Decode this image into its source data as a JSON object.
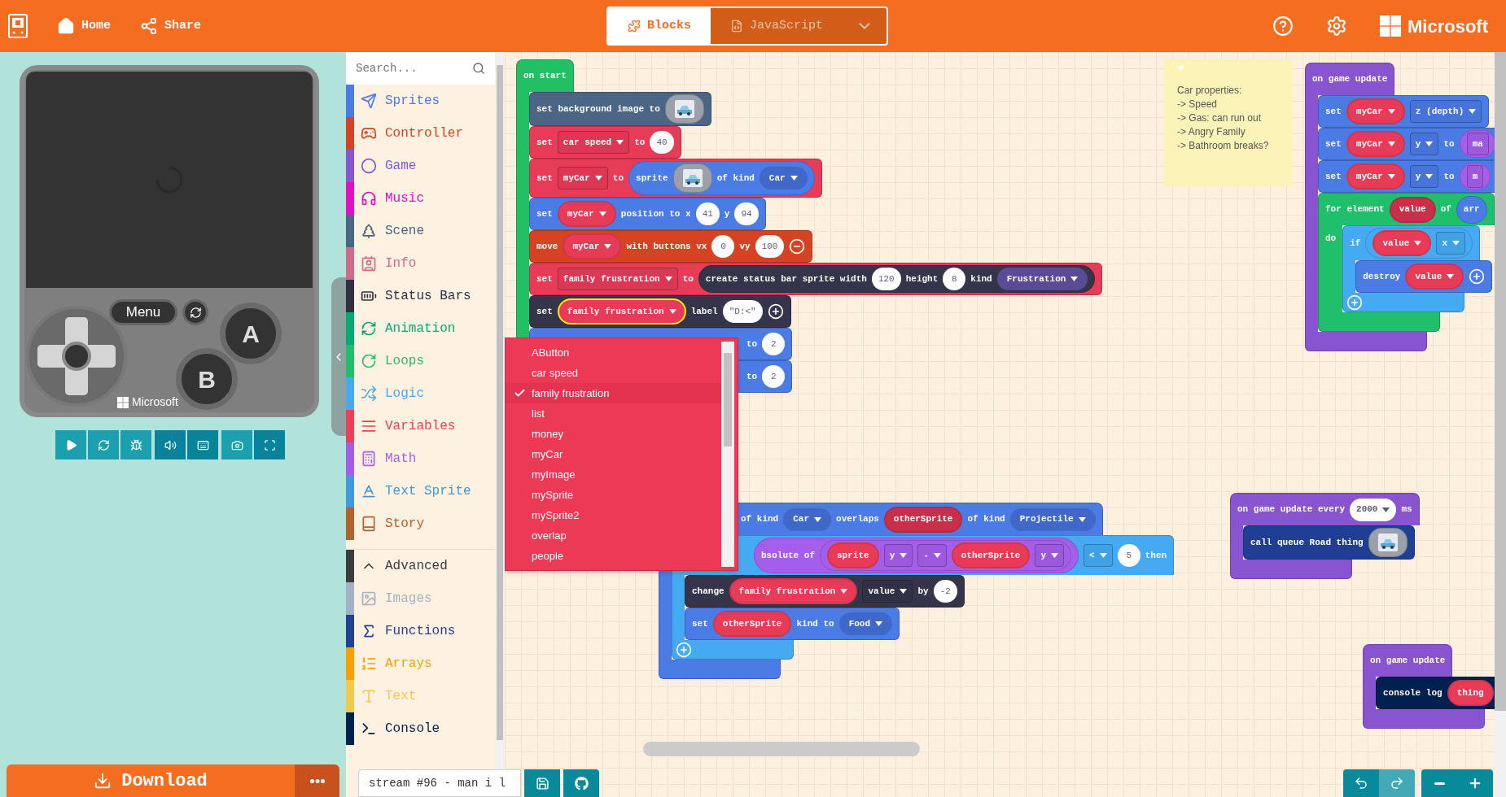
{
  "header": {
    "home": "Home",
    "share": "Share",
    "brand": "Microsoft",
    "tabs": [
      {
        "label": "Blocks",
        "selected": true
      },
      {
        "label": "JavaScript",
        "selected": false
      }
    ]
  },
  "simulator": {
    "menu": "Menu",
    "button_a": "A",
    "button_b": "B",
    "brand": "Microsoft"
  },
  "download": "Download",
  "toolbox": {
    "placeholder": "Search...",
    "categories": [
      {
        "label": "Sprites",
        "color": "#4b7be5"
      },
      {
        "label": "Controller",
        "color": "#d54322"
      },
      {
        "label": "Game",
        "color": "#8854d0"
      },
      {
        "label": "Music",
        "color": "#e30fc0"
      },
      {
        "label": "Scene",
        "color": "#4b6584"
      },
      {
        "label": "Info",
        "color": "#cf6a87"
      },
      {
        "label": "Status Bars",
        "color": "#303040"
      },
      {
        "label": "Animation",
        "color": "#03aa74"
      },
      {
        "label": "Loops",
        "color": "#20bf6b"
      },
      {
        "label": "Logic",
        "color": "#45aaf2"
      },
      {
        "label": "Variables",
        "color": "#ee3d55"
      },
      {
        "label": "Math",
        "color": "#a55eea"
      },
      {
        "label": "Text Sprite",
        "color": "#3e99de"
      },
      {
        "label": "Story",
        "color": "#b4612d"
      }
    ],
    "advanced": [
      {
        "label": "Advanced",
        "color": "#3c3c3c"
      },
      {
        "label": "Images",
        "color": "#a5b1c2"
      },
      {
        "label": "Functions",
        "color": "#204194"
      },
      {
        "label": "Arrays",
        "color": "#fe9f00"
      },
      {
        "label": "Text",
        "color": "#f2c94c"
      },
      {
        "label": "Console",
        "color": "#002050"
      }
    ]
  },
  "workspace": {
    "stacks": [
      {
        "color": "#23bf64",
        "parts": [
          {
            "kind": "text",
            "text": "on start"
          }
        ],
        "body": [
          {
            "color": "#4b6584",
            "parts": [
              {
                "kind": "text",
                "text": "set background image to"
              },
              {
                "kind": "image"
              }
            ]
          },
          {
            "color": "#e83b58",
            "parts": [
              {
                "kind": "text",
                "text": "set"
              },
              {
                "kind": "field",
                "text": "car speed",
                "caret": true
              },
              {
                "kind": "text",
                "text": "to"
              },
              {
                "kind": "number",
                "text": "40"
              }
            ]
          },
          {
            "color": "#e83b58",
            "parts": [
              {
                "kind": "text",
                "text": "set"
              },
              {
                "kind": "field",
                "text": "myCar",
                "caret": true
              },
              {
                "kind": "text",
                "text": "to"
              },
              {
                "kind": "reporter",
                "color": "#4b7be5",
                "parts": [
                  {
                    "kind": "text",
                    "text": "sprite"
                  },
                  {
                    "kind": "image"
                  },
                  {
                    "kind": "text",
                    "text": "of kind"
                  },
                  {
                    "kind": "enum",
                    "text": "Car",
                    "color": "#3f68c8"
                  }
                ]
              }
            ]
          },
          {
            "color": "#4b7be5",
            "parts": [
              {
                "kind": "text",
                "text": "set"
              },
              {
                "kind": "var",
                "text": "myCar",
                "color": "#e83b58",
                "caret": true
              },
              {
                "kind": "text",
                "text": "position to x"
              },
              {
                "kind": "number",
                "text": "41"
              },
              {
                "kind": "text",
                "text": "y"
              },
              {
                "kind": "number",
                "text": "94"
              }
            ]
          },
          {
            "color": "#d54322",
            "parts": [
              {
                "kind": "text",
                "text": "move"
              },
              {
                "kind": "var",
                "text": "myCar",
                "color": "#e83b58",
                "caret": true
              },
              {
                "kind": "text",
                "text": "with buttons vx"
              },
              {
                "kind": "number",
                "text": "0"
              },
              {
                "kind": "text",
                "text": "vy"
              },
              {
                "kind": "number",
                "text": "100"
              },
              {
                "kind": "minus"
              }
            ]
          },
          {
            "color": "#e83b58",
            "parts": [
              {
                "kind": "text",
                "text": "set"
              },
              {
                "kind": "field",
                "text": "family frustration",
                "caret": true
              },
              {
                "kind": "text",
                "text": "to"
              },
              {
                "kind": "reporter",
                "color": "#34344a",
                "parts": [
                  {
                    "kind": "text",
                    "text": "create status bar sprite width"
                  },
                  {
                    "kind": "number",
                    "text": "120"
                  },
                  {
                    "kind": "text",
                    "text": "height"
                  },
                  {
                    "kind": "number",
                    "text": "8"
                  },
                  {
                    "kind": "text",
                    "text": "kind"
                  },
                  {
                    "kind": "enum",
                    "text": "Frustration",
                    "color": "#5b4a96"
                  }
                ]
              }
            ]
          },
          {
            "color": "#34344a",
            "parts": [
              {
                "kind": "text",
                "text": "set"
              },
              {
                "kind": "var",
                "text": "family frustration",
                "color": "#e83b58",
                "caret": true,
                "highlighted": true
              },
              {
                "kind": "text",
                "text": "label"
              },
              {
                "kind": "number",
                "text": "\"D:<\""
              },
              {
                "kind": "plus"
              }
            ]
          },
          {
            "color": "#4b7be5",
            "parts": [
              {
                "kind": "covered"
              },
              {
                "kind": "text",
                "text": "to"
              },
              {
                "kind": "number",
                "text": "2"
              }
            ]
          },
          {
            "color": "#4b7be5",
            "parts": [
              {
                "kind": "covered"
              },
              {
                "kind": "text",
                "text": "to"
              },
              {
                "kind": "number",
                "text": "2"
              }
            ]
          }
        ]
      },
      {
        "color": "#8854d0",
        "parts": [
          {
            "kind": "text",
            "text": "on game update"
          }
        ],
        "body": [
          {
            "color": "#4b7be5",
            "parts": [
              {
                "kind": "text",
                "text": "set"
              },
              {
                "kind": "var",
                "text": "myCar",
                "color": "#e83b58",
                "caret": true
              },
              {
                "kind": "field",
                "text": "z (depth)",
                "caret": true
              }
            ]
          },
          {
            "color": "#4b7be5",
            "parts": [
              {
                "kind": "text",
                "text": "set"
              },
              {
                "kind": "var",
                "text": "myCar",
                "color": "#e83b58",
                "caret": true
              },
              {
                "kind": "field",
                "text": "y",
                "caret": true
              },
              {
                "kind": "text",
                "text": "to"
              },
              {
                "kind": "reporter",
                "color": "#a55eea",
                "parts": [
                  {
                    "kind": "field",
                    "text": "ma",
                    "caret": false
                  }
                ]
              }
            ]
          },
          {
            "color": "#4b7be5",
            "parts": [
              {
                "kind": "text",
                "text": "set"
              },
              {
                "kind": "var",
                "text": "myCar",
                "color": "#e83b58",
                "caret": true
              },
              {
                "kind": "field",
                "text": "y",
                "caret": true
              },
              {
                "kind": "text",
                "text": "to"
              },
              {
                "kind": "reporter",
                "color": "#a55eea",
                "parts": [
                  {
                    "kind": "field",
                    "text": "m",
                    "caret": false
                  }
                ]
              }
            ]
          },
          {
            "color": "#20bf6b",
            "parts": [
              {
                "kind": "text",
                "text": "for element"
              },
              {
                "kind": "var",
                "text": "value",
                "color": "#c8304a",
                "caret": false
              },
              {
                "kind": "text",
                "text": "of"
              },
              {
                "kind": "reporter",
                "color": "#4b7be5",
                "parts": [
                  {
                    "kind": "text",
                    "text": "arr"
                  }
                ]
              }
            ],
            "body_label": "do",
            "body": [
              {
                "color": "#45aaf2",
                "parts": [
                  {
                    "kind": "text",
                    "text": "if"
                  },
                  {
                    "kind": "reporter",
                    "color": "#45aaf2",
                    "parts": [
                      {
                        "kind": "var",
                        "text": "value",
                        "color": "#e83b58",
                        "caret": true
                      },
                      {
                        "kind": "field",
                        "text": "x",
                        "caret": true
                      }
                    ]
                  }
                ],
                "body": [
                  {
                    "color": "#4b7be5",
                    "parts": [
                      {
                        "kind": "text",
                        "text": "destroy"
                      },
                      {
                        "kind": "var",
                        "text": "value",
                        "color": "#e83b58",
                        "caret": true
                      },
                      {
                        "kind": "plus"
                      }
                    ]
                  }
                ],
                "footer": [
                  {
                    "kind": "plus"
                  }
                ]
              }
            ]
          }
        ]
      },
      {
        "color": "#4b7be5",
        "parts": [
          {
            "kind": "tucked"
          },
          {
            "kind": "text",
            "text": "of kind"
          },
          {
            "kind": "enum",
            "text": "Car",
            "color": "#3f68c8"
          },
          {
            "kind": "text",
            "text": "overlaps"
          },
          {
            "kind": "var",
            "text": "otherSprite",
            "color": "#c8304a",
            "caret": false
          },
          {
            "kind": "text",
            "text": "of kind"
          },
          {
            "kind": "enum",
            "text": "Projectile",
            "color": "#3f68c8"
          }
        ],
        "body": [
          {
            "color": "#45aaf2",
            "parts": [
              {
                "kind": "tucked"
              },
              {
                "kind": "reporter",
                "color": "#a55eea",
                "parts": [
                  {
                    "kind": "text",
                    "text": "bsolute of"
                  },
                  {
                    "kind": "reporter",
                    "color": "#a55eea",
                    "parts": [
                      {
                        "kind": "var",
                        "text": "sprite",
                        "color": "#e83b58",
                        "caret": false
                      },
                      {
                        "kind": "field",
                        "text": "y",
                        "caret": true
                      },
                      {
                        "kind": "field",
                        "text": "-",
                        "caret": true
                      },
                      {
                        "kind": "var",
                        "text": "otherSprite",
                        "color": "#e83b58",
                        "caret": false
                      },
                      {
                        "kind": "field",
                        "text": "y",
                        "caret": true
                      }
                    ]
                  }
                ]
              },
              {
                "kind": "field",
                "text": "<",
                "caret": true
              },
              {
                "kind": "number",
                "text": "5"
              },
              {
                "kind": "text",
                "text": "then"
              }
            ],
            "body": [
              {
                "color": "#34344a",
                "parts": [
                  {
                    "kind": "text",
                    "text": "change"
                  },
                  {
                    "kind": "var",
                    "text": "family frustration",
                    "color": "#e83b58",
                    "caret": true
                  },
                  {
                    "kind": "field",
                    "text": "value",
                    "caret": true
                  },
                  {
                    "kind": "text",
                    "text": "by"
                  },
                  {
                    "kind": "number",
                    "text": "-2"
                  }
                ]
              },
              {
                "color": "#4b7be5",
                "parts": [
                  {
                    "kind": "text",
                    "text": "set"
                  },
                  {
                    "kind": "var",
                    "text": "otherSprite",
                    "color": "#e83b58",
                    "caret": false
                  },
                  {
                    "kind": "text",
                    "text": "kind to"
                  },
                  {
                    "kind": "enum",
                    "text": "Food",
                    "color": "#3f68c8"
                  }
                ]
              }
            ],
            "footer": [
              {
                "kind": "plus"
              }
            ]
          }
        ]
      },
      {
        "color": "#8854d0",
        "parts": [
          {
            "kind": "text",
            "text": "on game update every"
          },
          {
            "kind": "choice",
            "text": "2000"
          },
          {
            "kind": "text",
            "text": "ms"
          }
        ],
        "body": [
          {
            "color": "#1f3f94",
            "parts": [
              {
                "kind": "text",
                "text": "call queue Road thing"
              },
              {
                "kind": "image"
              }
            ]
          }
        ]
      },
      {
        "color": "#8854d0",
        "parts": [
          {
            "kind": "text",
            "text": "on game update"
          }
        ],
        "body": [
          {
            "color": "#002050",
            "parts": [
              {
                "kind": "text",
                "text": "console log"
              },
              {
                "kind": "var",
                "text": "thing",
                "color": "#e83b58",
                "caret": false
              }
            ]
          }
        ]
      }
    ],
    "comment": {
      "lines": [
        "Car properties:",
        "-> Speed",
        "-> Gas: can run out",
        "-> Angry Family",
        "-> Bathroom breaks?"
      ]
    },
    "dropdown": {
      "items": [
        {
          "label": "AButton",
          "selected": false
        },
        {
          "label": "car speed",
          "selected": false
        },
        {
          "label": "family frustration",
          "selected": true
        },
        {
          "label": "list",
          "selected": false
        },
        {
          "label": "money",
          "selected": false
        },
        {
          "label": "myCar",
          "selected": false
        },
        {
          "label": "myImage",
          "selected": false
        },
        {
          "label": "mySprite",
          "selected": false
        },
        {
          "label": "mySprite2",
          "selected": false
        },
        {
          "label": "overlap",
          "selected": false
        },
        {
          "label": "people",
          "selected": false
        }
      ]
    }
  },
  "project": {
    "name": "stream #96 - man i l"
  }
}
